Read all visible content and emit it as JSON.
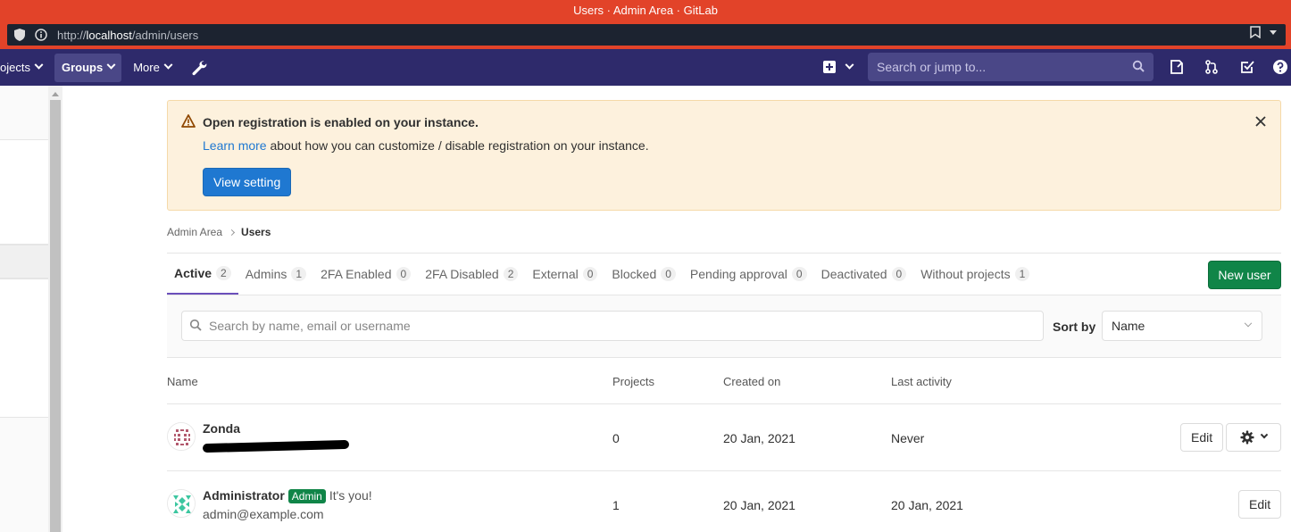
{
  "browser": {
    "window_title": "Users · Admin Area · GitLab",
    "url_prefix": "http://",
    "url_host": "localhost",
    "url_path": "/admin/users"
  },
  "navbar": {
    "projects_label": "ojects",
    "groups_label": "Groups",
    "more_label": "More",
    "search_placeholder": "Search or jump to..."
  },
  "alert": {
    "title": "Open registration is enabled on your instance.",
    "link_text": "Learn more",
    "body_text": " about how you can customize / disable registration on your instance.",
    "button_label": "View setting"
  },
  "breadcrumb": {
    "parent": "Admin Area",
    "current": "Users"
  },
  "tabs": [
    {
      "label": "Active",
      "count": "2"
    },
    {
      "label": "Admins",
      "count": "1"
    },
    {
      "label": "2FA Enabled",
      "count": "0"
    },
    {
      "label": "2FA Disabled",
      "count": "2"
    },
    {
      "label": "External",
      "count": "0"
    },
    {
      "label": "Blocked",
      "count": "0"
    },
    {
      "label": "Pending approval",
      "count": "0"
    },
    {
      "label": "Deactivated",
      "count": "0"
    },
    {
      "label": "Without projects",
      "count": "1"
    }
  ],
  "new_user_label": "New user",
  "filter": {
    "search_placeholder": "Search by name, email or username",
    "sort_label": "Sort by",
    "sort_value": "Name"
  },
  "table": {
    "headers": {
      "name": "Name",
      "projects": "Projects",
      "created": "Created on",
      "activity": "Last activity"
    },
    "rows": [
      {
        "name": "Zonda",
        "email": "",
        "projects": "0",
        "created": "20 Jan, 2021",
        "activity": "Never",
        "edit_label": "Edit"
      },
      {
        "name": "Administrator",
        "badge": "Admin",
        "note": "It's you!",
        "email": "admin@example.com",
        "projects": "1",
        "created": "20 Jan, 2021",
        "activity": "20 Jan, 2021",
        "edit_label": "Edit"
      }
    ]
  },
  "colors": {
    "browser_bar": "#e24329",
    "navbar": "#2e2a6b",
    "alert_bg": "#fdf1dd",
    "primary": "#1f78d1",
    "success": "#108548",
    "active_tab": "#6b4fbb"
  }
}
